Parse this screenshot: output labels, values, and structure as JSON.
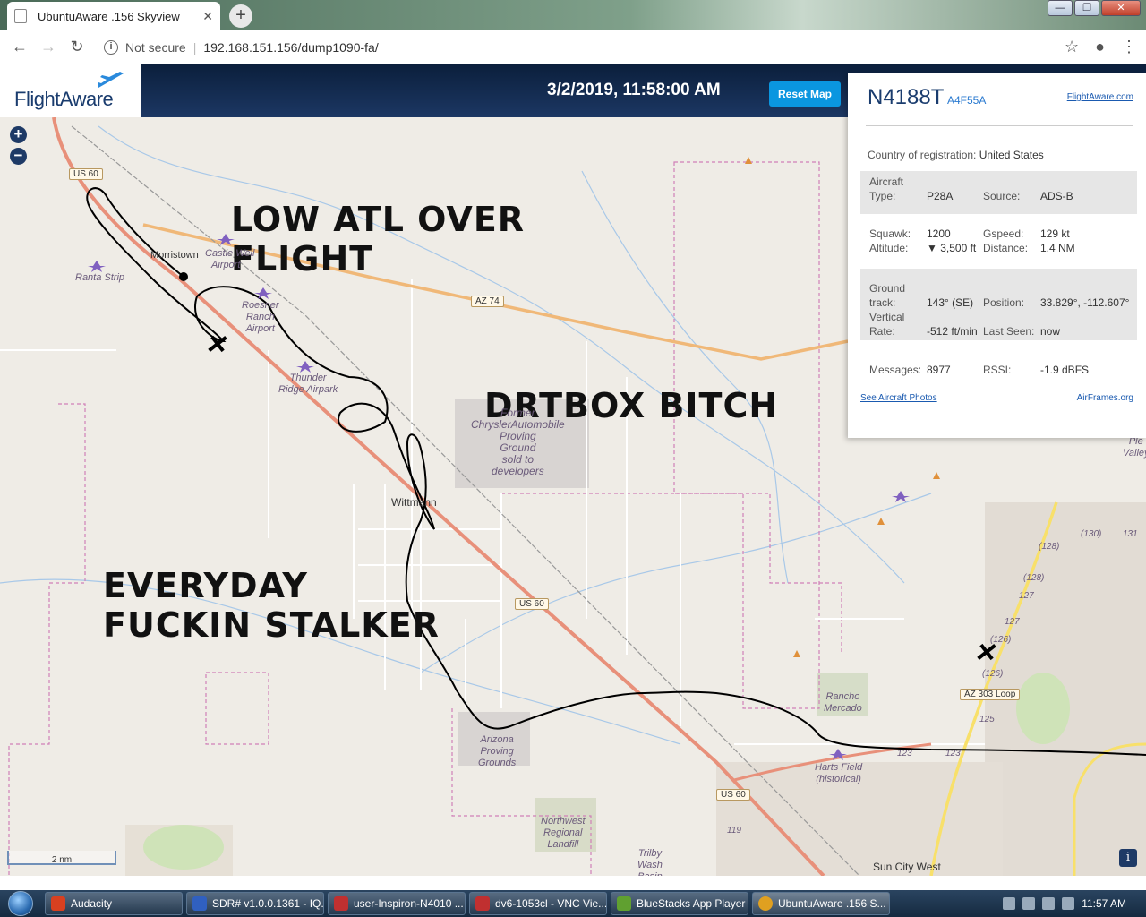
{
  "browser": {
    "tab_title": "UbuntuAware .156 Skyview",
    "tab_close": "✕",
    "new_tab": "+",
    "security": "Not secure",
    "url": "192.168.151.156/dump1090-fa/",
    "win_minimize": "—",
    "win_restore": "❐",
    "win_close": "✕"
  },
  "header": {
    "logo_text": "FlightAware",
    "timestamp": "3/2/2019, 11:58:00 AM",
    "reset_label": "Reset Map"
  },
  "map": {
    "zoom_in": "+",
    "zoom_out": "−",
    "scale_label": "2 nm",
    "info_button": "i",
    "overlay_texts": {
      "low_atl_1": "LOW ATL OVER",
      "low_atl_2": "FLIGHT",
      "drtbox": "DRTBOX BITCH",
      "everyday_1": "EVERYDAY",
      "everyday_2": "FUCKIN STALKER"
    },
    "places": {
      "morristown": "Morristown",
      "wittmann": "Wittmann",
      "sun_city_west": "Sun City West",
      "castle_well": "Castle Well",
      "castle_well_2": "Airport",
      "ranta": "Ranta Strip",
      "roesner": "Roesner\nRanch\nAirport",
      "thunder": "Thunder\nRidge Airpark",
      "chrysler": "Former\nChryslerAutomobile\nProving\nGround\nsold to\ndevelopers",
      "arizona_pg": "Arizona\nProving\nGrounds",
      "rancho": "Rancho\nMercado",
      "harts": "Harts Field\n(historical)",
      "northwest": "Northwest\nRegional\nLandfill",
      "trilby": "Trilby\nWash\nBasin",
      "pleasant": "Ple\nValley"
    },
    "roads": {
      "us60_a": "US 60",
      "us60_b": "US 60",
      "us60_c": "US 60",
      "az74": "AZ 74",
      "az303": "AZ 303 Loop"
    },
    "mile_markers": [
      "(128)",
      "(130)",
      "131",
      "(128)",
      "127",
      "127",
      "(126)",
      "(126)",
      "125",
      "123",
      "123",
      "119"
    ]
  },
  "aircraft": {
    "callsign": "N4188T",
    "hex": "A4F55A",
    "fa_link": "FlightAware.com",
    "country_label": "Country of registration:",
    "country": "United States",
    "type_label": "Aircraft\nType:",
    "type": "P28A",
    "source_label": "Source:",
    "source": "ADS-B",
    "squawk_label": "Squawk:",
    "squawk": "1200",
    "altitude_label": "Altitude:",
    "altitude": "▼ 3,500 ft",
    "gspeed_label": "Gspeed:",
    "gspeed": "129 kt",
    "distance_label": "Distance:",
    "distance": "1.4 NM",
    "track_label": "Ground\ntrack:",
    "track": "143° (SE)",
    "position_label": "Position:",
    "position": "33.829°, -112.607°",
    "vrate_label": "Vertical\nRate:",
    "vrate": "-512 ft/min",
    "lastseen_label": "Last Seen:",
    "lastseen": "now",
    "messages_label": "Messages:",
    "messages": "8977",
    "rssi_label": "RSSI:",
    "rssi": "-1.9 dBFS",
    "photos_link": "See Aircraft Photos",
    "airframes_link": "AirFrames.org"
  },
  "taskbar": {
    "items": [
      {
        "label": "Audacity",
        "color": "#d84020"
      },
      {
        "label": "SDR# v1.0.0.1361 - IQ...",
        "color": "#3060c0"
      },
      {
        "label": "user-Inspiron-N4010 ...",
        "color": "#c03030"
      },
      {
        "label": "dv6-1053cl - VNC Vie...",
        "color": "#c03030"
      },
      {
        "label": "BlueStacks App Player",
        "color": "#60a030"
      },
      {
        "label": "UbuntuAware .156 S...",
        "color": "#e0a020"
      }
    ],
    "clock": "11:57 AM"
  },
  "colors": {
    "header_bg": "#14305a",
    "accent": "#0a96e0",
    "track_line": "#000000",
    "highway": "#e8907a",
    "state_route": "#f0b878",
    "boundary": "#d080b8",
    "water": "#a8c8e8"
  }
}
